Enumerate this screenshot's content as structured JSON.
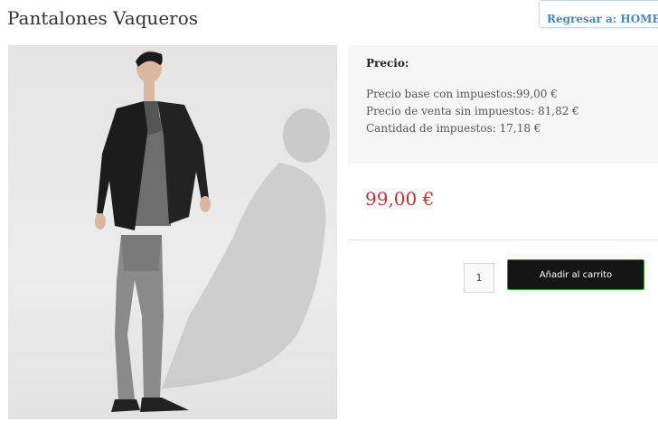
{
  "product": {
    "title": "Pantalones Vaqueros",
    "image_alt": "model-photo"
  },
  "nav": {
    "back_label": "Regresar a: HOMBRE"
  },
  "pricing": {
    "label": "Precio:",
    "base_with_tax": "Precio base con impuestos:99,00 €",
    "sale_without_tax": "Precio de venta sin impuestos: 81,82 €",
    "tax_amount": "Cantidad de impuestos: 17,18 €",
    "display_price": "99,00 €"
  },
  "cart": {
    "quantity": "1",
    "add_label": "Añadir al carrito"
  },
  "colors": {
    "price_red": "#d12d2d",
    "link_blue": "#4a86c5",
    "button_dark": "#151515",
    "button_border_green": "#2ea12e"
  }
}
